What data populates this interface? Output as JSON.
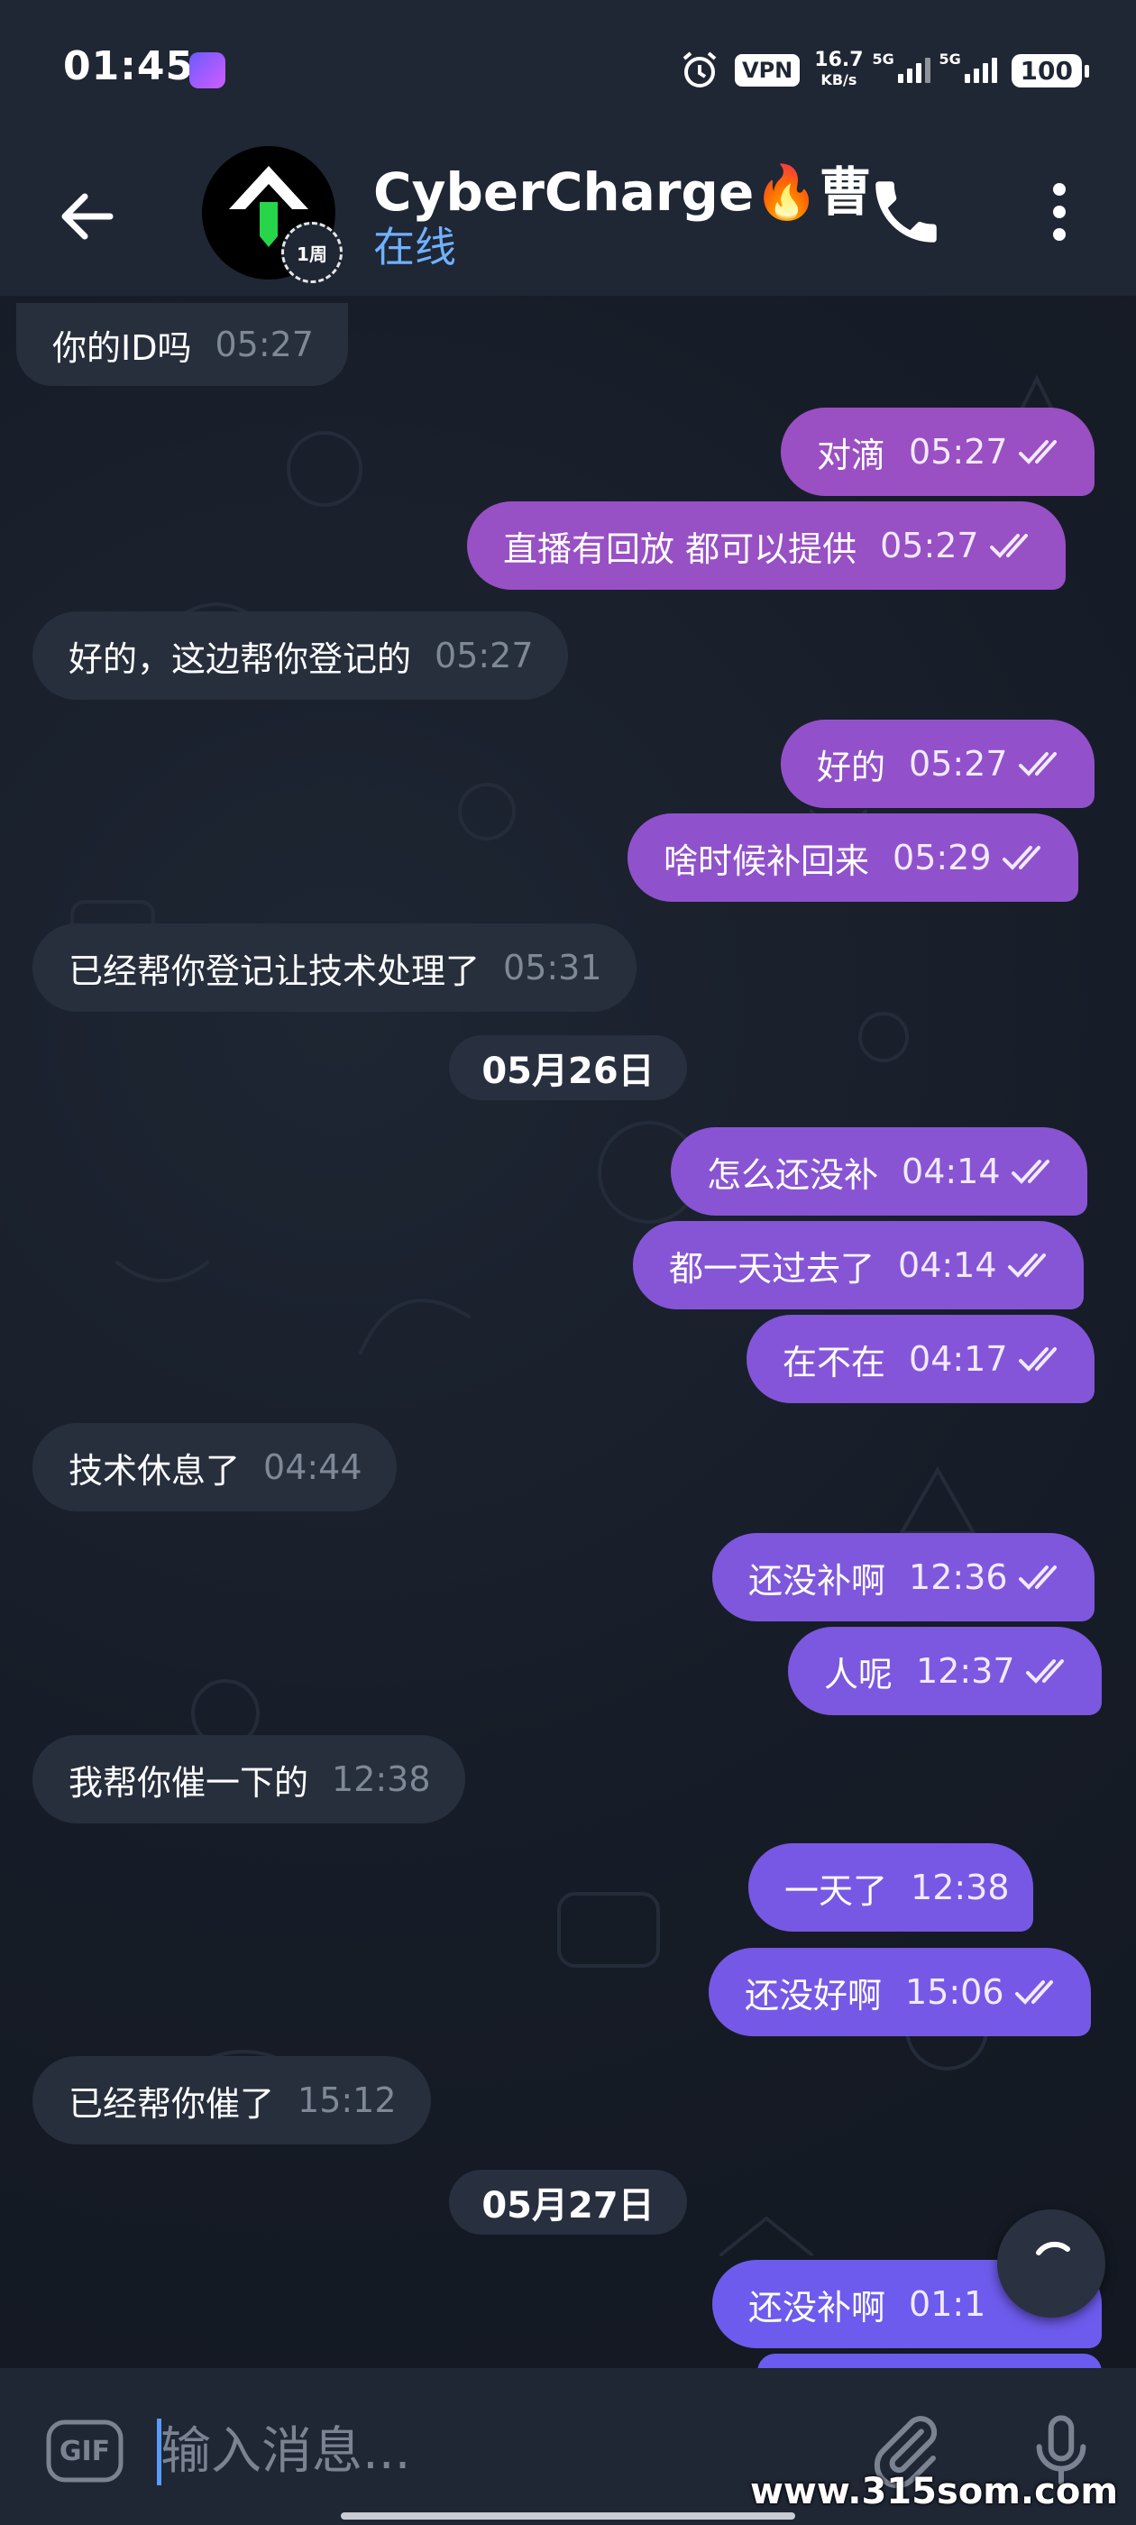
{
  "status_bar": {
    "time": "01:45",
    "vpn": "VPN",
    "net_speed_value": "16.7",
    "net_speed_unit": "KB/s",
    "sim1": "5G",
    "sim2": "5G",
    "battery": "100"
  },
  "header": {
    "name": "CyberCharge🔥曹",
    "status": "在线",
    "story_badge": "1周"
  },
  "messages": [
    {
      "dir": "in",
      "text": "你的ID吗",
      "time": "05:27"
    },
    {
      "dir": "out",
      "text": "对滴",
      "time": "05:27"
    },
    {
      "dir": "out",
      "text": "直播有回放 都可以提供",
      "time": "05:27"
    },
    {
      "dir": "in",
      "text": "好的，这边帮你登记的",
      "time": "05:27"
    },
    {
      "dir": "out",
      "text": "好的",
      "time": "05:27"
    },
    {
      "dir": "out",
      "text": "啥时候补回来",
      "time": "05:29"
    },
    {
      "dir": "in",
      "text": "已经帮你登记让技术处理了",
      "time": "05:31"
    },
    {
      "dir": "out",
      "text": "怎么还没补",
      "time": "04:14"
    },
    {
      "dir": "out",
      "text": "都一天过去了",
      "time": "04:14"
    },
    {
      "dir": "out",
      "text": "在不在",
      "time": "04:17"
    },
    {
      "dir": "in",
      "text": "技术休息了",
      "time": "04:44"
    },
    {
      "dir": "out",
      "text": "还没补啊",
      "time": "12:36"
    },
    {
      "dir": "out",
      "text": "人呢",
      "time": "12:37"
    },
    {
      "dir": "in",
      "text": "我帮你催一下的",
      "time": "12:38"
    },
    {
      "dir": "out",
      "text": "一天了",
      "time": "12:38"
    },
    {
      "dir": "out",
      "text": "还没好啊",
      "time": "15:06"
    },
    {
      "dir": "in",
      "text": "已经帮你催了",
      "time": "15:12"
    },
    {
      "dir": "out",
      "text": "还没补啊",
      "time": "01:1"
    }
  ],
  "dates": [
    "05月26日",
    "05月27日"
  ],
  "input": {
    "placeholder": "输入消息...",
    "gif_label": "GIF"
  },
  "watermark": "www.315som.com",
  "colors": {
    "header_bg": "#1f2634",
    "incoming_bubble": "#272f3d",
    "outgoing_gradient_top": "#9b4fc2",
    "outgoing_gradient_bottom": "#6a5cf0",
    "online_status": "#6fb1ff"
  },
  "icons": [
    "back-arrow-icon",
    "phone-icon",
    "more-vert-icon",
    "double-check-icon",
    "gif-icon",
    "paperclip-icon",
    "microphone-icon",
    "alarm-icon",
    "loading-spinner-icon"
  ]
}
